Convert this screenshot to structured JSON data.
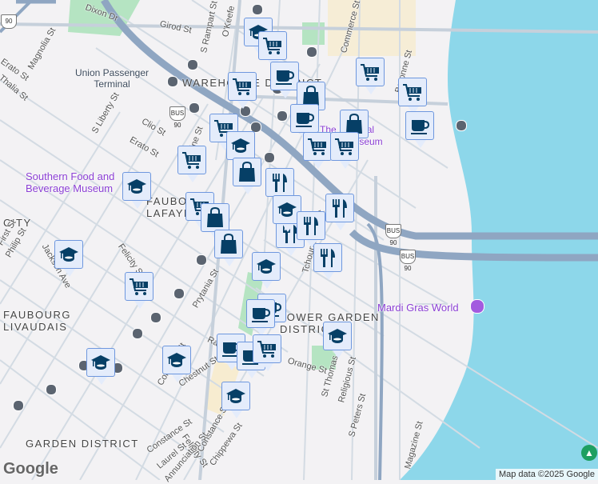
{
  "map": {
    "attribution": "Map data ©2025 Google",
    "logo": "Google",
    "colors": {
      "water": "#8dd7ea",
      "park": "#b5e4c2",
      "highway": "#8fa6c2",
      "road": "#d3dbe3",
      "marker_fill": "#e4ecfb",
      "marker_border": "#6e97de",
      "marker_icon": "#063f66",
      "poi": "#8b3fd4"
    },
    "neighborhoods": [
      "WAREHOUSE DISTRICT",
      "FAUBOURG LAFAYETTE",
      "CITY",
      "FAUBOURG LIVAUDAIS",
      "LOWER GARDEN DISTRICT",
      "GARDEN DISTRICT"
    ],
    "pois": [
      "Southern Food and Beverage Museum",
      "Mardi Gras World",
      "The National WWII Museum",
      "Union Passenger Terminal"
    ],
    "streets": [
      "Dixon Dr",
      "Girod St",
      "S Rampart St",
      "O'Keefe",
      "Erato St",
      "Magnolia St",
      "Thalia St",
      "S Liberty St",
      "Clio St",
      "Erato St",
      "Felicity St",
      "Prytania St",
      "Philip St",
      "First St",
      "Jackson Ave",
      "Chestnut St",
      "Coliseum St",
      "Race St",
      "Orange St",
      "Felicity St",
      "Constance St",
      "Laurel St",
      "Annunciation St",
      "Chippewa St",
      "St Thomas St",
      "Religious St",
      "S Peters St",
      "Magazine St",
      "Constance St",
      "Tchoupitoulas St",
      "Commerce St",
      "Baronne St",
      "Magazine St"
    ],
    "route_shields": [
      "BUS 90",
      "BUS 90",
      "BUS 90",
      "90"
    ],
    "markers": [
      "school",
      "grocery",
      "cafe",
      "grocery",
      "shopping",
      "cafe",
      "shopping",
      "grocery",
      "grocery",
      "cafe",
      "grocery",
      "grocery",
      "grocery",
      "school",
      "grocery",
      "shopping",
      "restaurant",
      "school",
      "grocery",
      "shopping",
      "shopping",
      "restaurant",
      "restaurant",
      "school",
      "restaurant",
      "restaurant",
      "school",
      "school",
      "grocery",
      "cafe",
      "cafe",
      "school",
      "cafe",
      "cafe",
      "grocery",
      "school",
      "school",
      "school"
    ]
  }
}
